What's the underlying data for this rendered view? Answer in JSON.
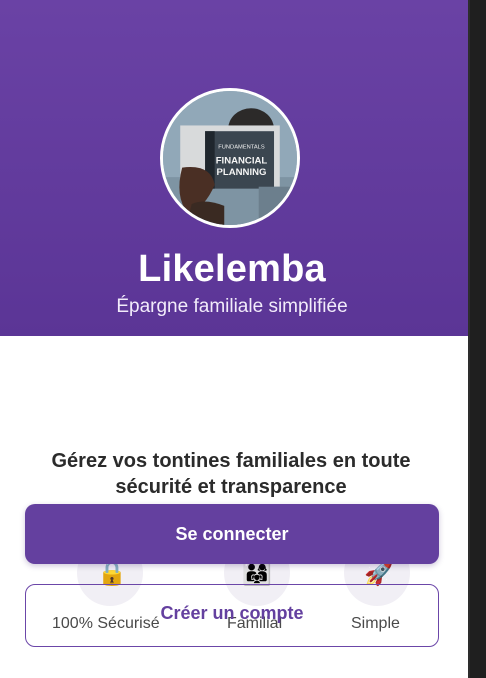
{
  "app": {
    "title": "Likelemba",
    "subtitle": "Épargne familiale simplifiée"
  },
  "hero": {
    "book_cover_line1": "FUNDAMENTALS",
    "book_cover_line2": "FINANCIAL",
    "book_cover_line3": "PLANNING"
  },
  "headline": {
    "line1": "Gérez vos tontines familiales en toute",
    "line2": "sécurité et transparence"
  },
  "features": [
    {
      "icon": "lock-icon",
      "emoji": "🔒",
      "label": "100% Sécurisé"
    },
    {
      "icon": "family-icon",
      "emoji": "👨‍👩‍👧",
      "label": "Familial"
    },
    {
      "icon": "rocket-icon",
      "emoji": "🚀",
      "label": "Simple"
    }
  ],
  "actions": {
    "login_label": "Se connecter",
    "signup_label": "Créer un compte"
  },
  "colors": {
    "primary": "#64409f",
    "hero_top": "#6a42a5",
    "hero_bottom": "#5b3596"
  }
}
